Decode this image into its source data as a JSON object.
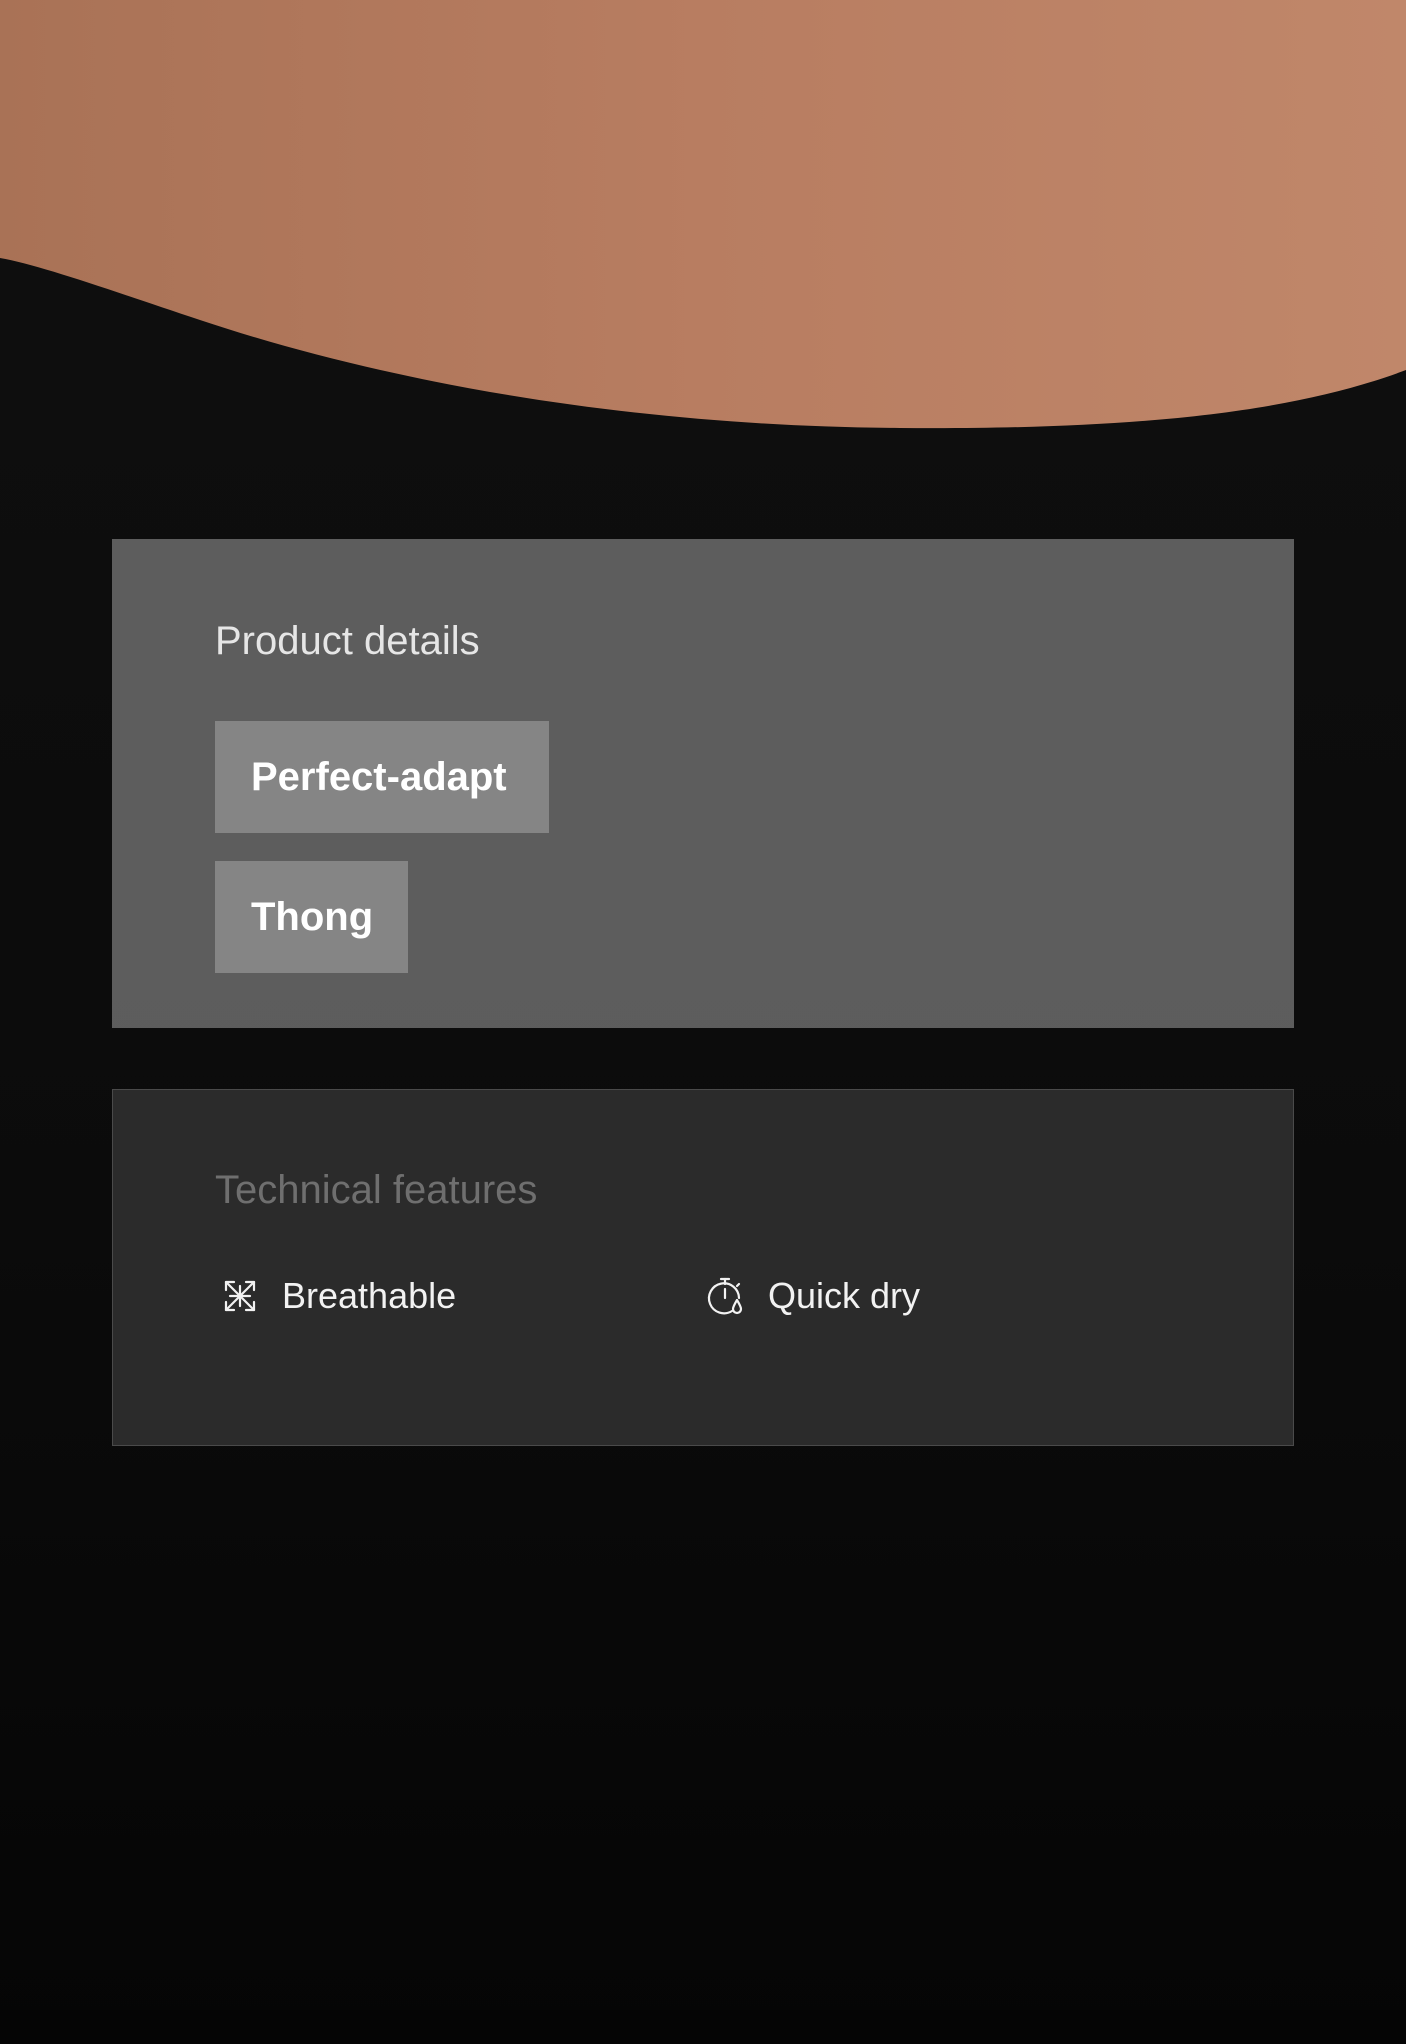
{
  "product_details": {
    "title": "Product details",
    "chips": [
      {
        "label": "Perfect-adapt"
      },
      {
        "label": "Thong"
      }
    ]
  },
  "technical_features": {
    "title": "Technical features",
    "items": [
      {
        "label": "Breathable",
        "icon": "breathable-icon"
      },
      {
        "label": "Quick dry",
        "icon": "quick-dry-icon"
      }
    ]
  }
}
